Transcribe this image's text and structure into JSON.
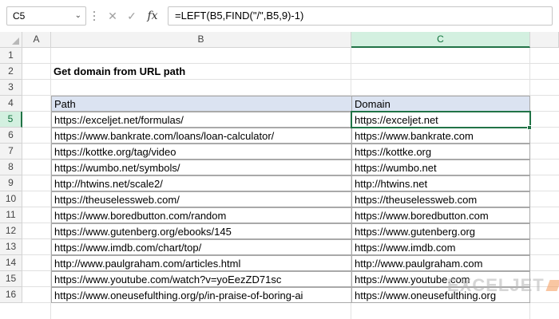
{
  "formula_bar": {
    "name_box": "C5",
    "formula": "=LEFT(B5,FIND(\"/\",B5,9)-1)",
    "fx_label": "fx",
    "cancel_glyph": "✕",
    "enter_glyph": "✓"
  },
  "columns": [
    "A",
    "B",
    "C"
  ],
  "rows": [
    "1",
    "2",
    "3",
    "4",
    "5",
    "6",
    "7",
    "8",
    "9",
    "10",
    "11",
    "12",
    "13",
    "14",
    "15",
    "16"
  ],
  "selected_column": "C",
  "selected_row": "5",
  "title": "Get domain from URL path",
  "table": {
    "headers": {
      "path": "Path",
      "domain": "Domain"
    },
    "rows": [
      {
        "path": "https://exceljet.net/formulas/",
        "domain": "https://exceljet.net"
      },
      {
        "path": "https://www.bankrate.com/loans/loan-calculator/",
        "domain": "https://www.bankrate.com"
      },
      {
        "path": "https://kottke.org/tag/video",
        "domain": "https://kottke.org"
      },
      {
        "path": "https://wumbo.net/symbols/",
        "domain": "https://wumbo.net"
      },
      {
        "path": "http://htwins.net/scale2/",
        "domain": "http://htwins.net"
      },
      {
        "path": "https://theuselessweb.com/",
        "domain": "https://theuselessweb.com"
      },
      {
        "path": "https://www.boredbutton.com/random",
        "domain": "https://www.boredbutton.com"
      },
      {
        "path": "https://www.gutenberg.org/ebooks/145",
        "domain": "https://www.gutenberg.org"
      },
      {
        "path": "https://www.imdb.com/chart/top/",
        "domain": "https://www.imdb.com"
      },
      {
        "path": "http://www.paulgraham.com/articles.html",
        "domain": "http://www.paulgraham.com"
      },
      {
        "path": "https://www.youtube.com/watch?v=yoEezZD71sc",
        "domain": "https://www.youtube.com"
      },
      {
        "path": "https://www.oneusefulthing.org/p/in-praise-of-boring-ai",
        "domain": "https://www.oneusefulthing.org"
      }
    ]
  },
  "watermark": "EXCELJET",
  "colors": {
    "accent": "#217346",
    "table_header": "#dbe3f1",
    "selected_header": "#d3f0e0"
  }
}
